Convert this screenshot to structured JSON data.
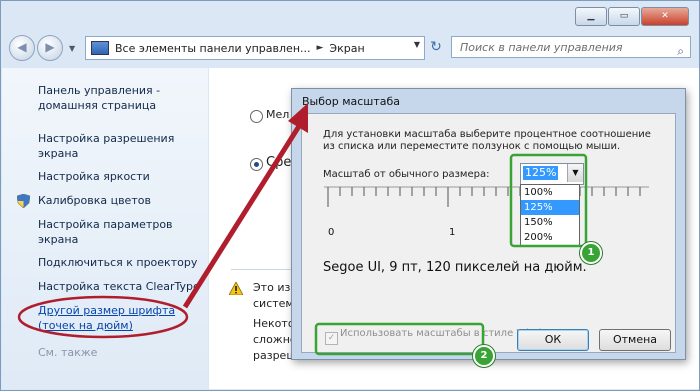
{
  "window": {
    "controls": {
      "minimize": "▁",
      "maximize": "▭",
      "close": "✕"
    }
  },
  "nav": {
    "back_icon": "◀",
    "forward_icon": "▶",
    "history_dropdown": "▼",
    "address": {
      "icon": "control-panel-icon",
      "segment1": "Все элементы панели управлен...",
      "separator": "►",
      "segment2": "Экран",
      "dropdown": "▼"
    },
    "refresh": "↻",
    "search_placeholder": "Поиск в панели управления",
    "search_icon": "⌕"
  },
  "sidebar": {
    "home": "Панель управления - домашняя страница",
    "items": [
      {
        "label": "Настройка разрешения экрана"
      },
      {
        "label": "Настройка яркости"
      },
      {
        "label": "Калибровка цветов"
      },
      {
        "label": "Настройка параметров экрана"
      },
      {
        "label": "Подключиться к проектору"
      },
      {
        "label": "Настройка текста ClearType"
      },
      {
        "label": "Другой размер шрифта (точек на дюйм)"
      }
    ],
    "see_also": "См. также"
  },
  "main": {
    "radio1_label": "Мел",
    "radio2_label": "Сред",
    "warning_lines": [
      "Это изм",
      "систем",
      "Некото",
      "сложно",
      "разреш"
    ]
  },
  "dialog": {
    "title": "Выбор масштаба",
    "instruction_line1": "Для установки масштаба выберите процентное соотношение",
    "instruction_line2": "из списка или переместите ползунок с помощью мыши.",
    "scale_label": "Масштаб от обычного размера:",
    "scale_value": "125%",
    "scale_options": [
      "100%",
      "125%",
      "150%",
      "200%"
    ],
    "selected_option_index": 1,
    "ruler_labels": [
      "0",
      "1"
    ],
    "sample_text": "Segoe UI, 9 пт, 120 пикселей на дюйм.",
    "xp_checkbox_label": "Использовать масштабы в стиле Windows XP",
    "xp_checkbox_checked": true,
    "ok_label": "ОК",
    "cancel_label": "Отмена"
  },
  "annotations": {
    "badge1": "1",
    "badge2": "2",
    "highlight_color": "#3aa335",
    "arrow_color": "#b01e2d"
  }
}
